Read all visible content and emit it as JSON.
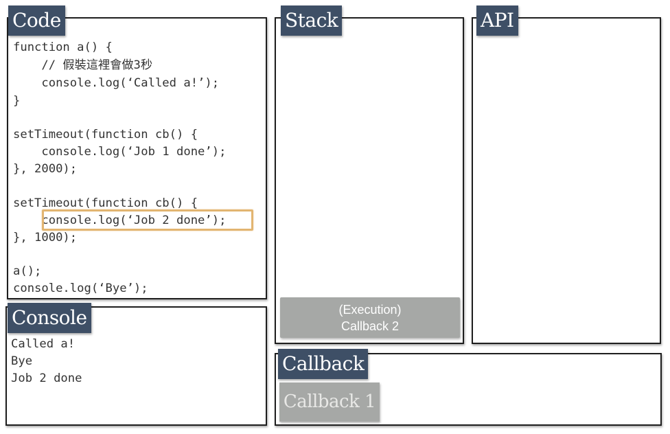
{
  "panels": {
    "code": {
      "title": "Code",
      "lines": [
        "function a() {",
        "    // 假裝這裡會做3秒",
        "    console.log(‘Called a!’);",
        "}",
        "",
        "setTimeout(function cb() {",
        "    console.log(‘Job 1 done’);",
        "}, 2000);",
        "",
        "setTimeout(function cb() {",
        "    console.log(‘Job 2 done’);",
        "}, 1000);",
        "",
        "a();",
        "console.log(‘Bye’);"
      ]
    },
    "console": {
      "title": "Console",
      "lines": [
        "Called a!",
        "Bye",
        "Job 2 done"
      ]
    },
    "stack": {
      "title": "Stack",
      "execution_label": "(Execution)",
      "execution_item": "Callback 2"
    },
    "api": {
      "title": "API"
    },
    "callback": {
      "title": "Callback",
      "items": [
        "Callback 1"
      ]
    }
  },
  "colors": {
    "tag_bg": "#3e4f66",
    "highlight": "#e2b571",
    "item_bg": "#a6a8a6"
  }
}
